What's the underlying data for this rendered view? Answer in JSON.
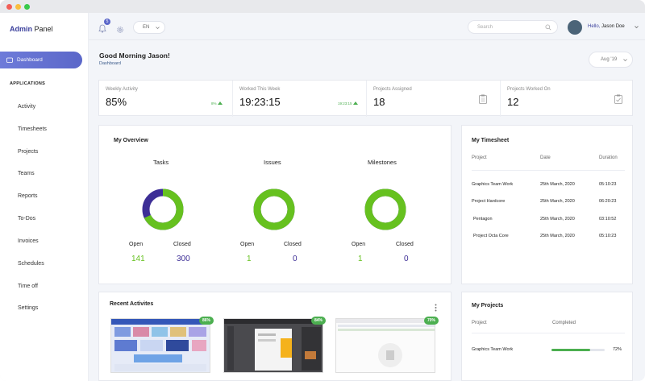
{
  "sidebar": {
    "brand_accent": "Admin",
    "brand_rest": " Panel",
    "active_item": "Dashboard",
    "section_label": "APPLICATIONS",
    "items": [
      "Activity",
      "Timesheets",
      "Projects",
      "Teams",
      "Reports",
      "To-Dos",
      "Invoices",
      "Schedules",
      "Time off",
      "Settings"
    ]
  },
  "topbar": {
    "notification_count": "5",
    "language": "EN",
    "search_placeholder": "Search",
    "greeting_prefix": "Hello, ",
    "user_name": "Jason Doe"
  },
  "header": {
    "greeting": "Good Morning Jason!",
    "breadcrumb": "Dashboard",
    "date_filter": "Aug '19"
  },
  "stats": [
    {
      "label": "Weekly Activity",
      "value": "85%",
      "trend": "8%"
    },
    {
      "label": "Worked This Week",
      "value": "19:23:15",
      "trend": "19:23:15"
    },
    {
      "label": "Projects Assigned",
      "value": "18"
    },
    {
      "label": "Projects Worked On",
      "value": "12"
    }
  ],
  "overview": {
    "title": "My Overview",
    "open_label": "Open",
    "closed_label": "Closed",
    "groups": [
      {
        "title": "Tasks",
        "open": "141",
        "closed": "300",
        "closed_fraction": 0.68
      },
      {
        "title": "Issues",
        "open": "1",
        "closed": "0",
        "closed_fraction": 1.0
      },
      {
        "title": "Milestones",
        "open": "1",
        "closed": "0",
        "closed_fraction": 1.0
      }
    ]
  },
  "timesheet": {
    "title": "My Timesheet",
    "headers": [
      "Project",
      "Date",
      "Duration"
    ],
    "rows": [
      [
        "Graphics Team Work",
        "25th March, 2020",
        "05:10:23"
      ],
      [
        "Project Hardcore",
        "25th March, 2020",
        "06:20:23"
      ],
      [
        "Pentagon",
        "25th March, 2020",
        "03:10:52"
      ],
      [
        "Project Octa Core",
        "25th March, 2020",
        "05:10:23"
      ]
    ]
  },
  "activities": {
    "title": "Recent Activites",
    "items": [
      {
        "percent": "86%"
      },
      {
        "percent": "84%"
      },
      {
        "percent": "70%"
      }
    ]
  },
  "projects": {
    "title": "My Projects",
    "headers": [
      "Project",
      "Completed"
    ],
    "rows": [
      {
        "name": "Graphics Team Work",
        "percent": "72%",
        "fraction": 0.72
      }
    ]
  },
  "colors": {
    "accent": "#3a3f9c",
    "green": "#66c11f",
    "purple": "#3d2e96",
    "trend_green": "#4caf50"
  }
}
